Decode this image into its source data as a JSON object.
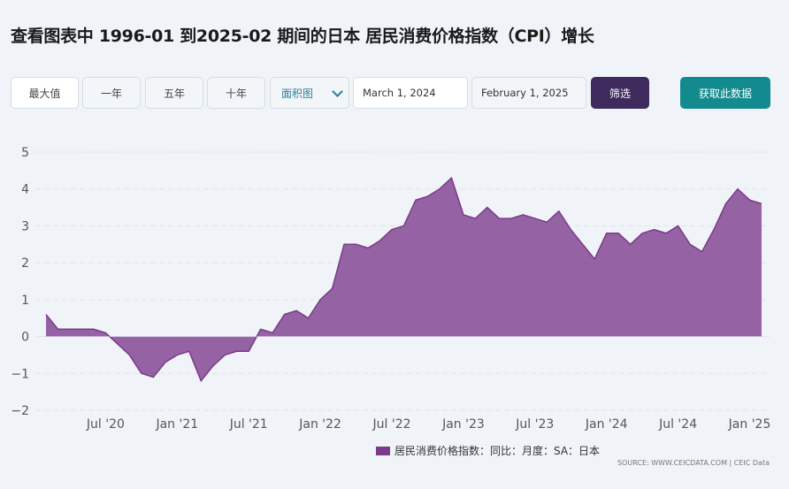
{
  "title": "查看图表中 1996-01 到2025-02 期间的日本 居民消费价格指数（CPI）增长",
  "controls": {
    "max_label": "最大值",
    "one_year": "一年",
    "five_year": "五年",
    "ten_year": "十年",
    "chart_type": "面积图",
    "date_from": "March 1, 2024",
    "date_to": "February 1, 2025",
    "filter_label": "筛选",
    "get_data_label": "获取此数据"
  },
  "colors": {
    "series": "#7b3a8a",
    "filter_button": "#3e2a5c",
    "get_button": "#138a8d"
  },
  "legend_label": "居民消费价格指数：同比：月度：SA：日本",
  "source": "SOURCE: WWW.CEICDATA.COM | CEIC Data",
  "chart_data": {
    "type": "area",
    "title": "",
    "xlabel": "",
    "ylabel": "",
    "ylim": [
      -2,
      5
    ],
    "yticks": [
      5,
      4,
      3,
      2,
      1,
      0,
      -1,
      -2
    ],
    "xtick_labels": [
      {
        "label": "Jul '20",
        "x": "2020-07"
      },
      {
        "label": "Jan '21",
        "x": "2021-01"
      },
      {
        "label": "Jul '21",
        "x": "2021-07"
      },
      {
        "label": "Jan '22",
        "x": "2022-01"
      },
      {
        "label": "Jul '22",
        "x": "2022-07"
      },
      {
        "label": "Jan '23",
        "x": "2023-01"
      },
      {
        "label": "Jul '23",
        "x": "2023-07"
      },
      {
        "label": "Jan '24",
        "x": "2024-01"
      },
      {
        "label": "Jul '24",
        "x": "2024-07"
      },
      {
        "label": "Jan '25",
        "x": "2025-01"
      }
    ],
    "grid": true,
    "legend_position": "bottom",
    "series": [
      {
        "name": "居民消费价格指数：同比：月度：SA：日本",
        "x": [
          "2020-02",
          "2020-03",
          "2020-04",
          "2020-05",
          "2020-06",
          "2020-07",
          "2020-08",
          "2020-09",
          "2020-10",
          "2020-11",
          "2020-12",
          "2021-01",
          "2021-02",
          "2021-03",
          "2021-04",
          "2021-05",
          "2021-06",
          "2021-07",
          "2021-08",
          "2021-09",
          "2021-10",
          "2021-11",
          "2021-12",
          "2022-01",
          "2022-02",
          "2022-03",
          "2022-04",
          "2022-05",
          "2022-06",
          "2022-07",
          "2022-08",
          "2022-09",
          "2022-10",
          "2022-11",
          "2022-12",
          "2023-01",
          "2023-02",
          "2023-03",
          "2023-04",
          "2023-05",
          "2023-06",
          "2023-07",
          "2023-08",
          "2023-09",
          "2023-10",
          "2023-11",
          "2023-12",
          "2024-01",
          "2024-02",
          "2024-03",
          "2024-04",
          "2024-05",
          "2024-06",
          "2024-07",
          "2024-08",
          "2024-09",
          "2024-10",
          "2024-11",
          "2024-12",
          "2025-01",
          "2025-02"
        ],
        "values": [
          0.6,
          0.2,
          0.2,
          0.2,
          0.2,
          0.1,
          -0.2,
          -0.5,
          -1.0,
          -1.1,
          -0.7,
          -0.5,
          -0.4,
          -1.2,
          -0.8,
          -0.5,
          -0.4,
          -0.4,
          0.2,
          0.1,
          0.6,
          0.7,
          0.5,
          1.0,
          1.3,
          2.5,
          2.5,
          2.4,
          2.6,
          2.9,
          3.0,
          3.7,
          3.8,
          4.0,
          4.3,
          3.3,
          3.2,
          3.5,
          3.2,
          3.2,
          3.3,
          3.2,
          3.1,
          3.4,
          2.9,
          2.5,
          2.1,
          2.8,
          2.8,
          2.5,
          2.8,
          2.9,
          2.8,
          3.0,
          2.5,
          2.3,
          2.9,
          3.6,
          4.0,
          3.7,
          3.6
        ]
      }
    ]
  }
}
